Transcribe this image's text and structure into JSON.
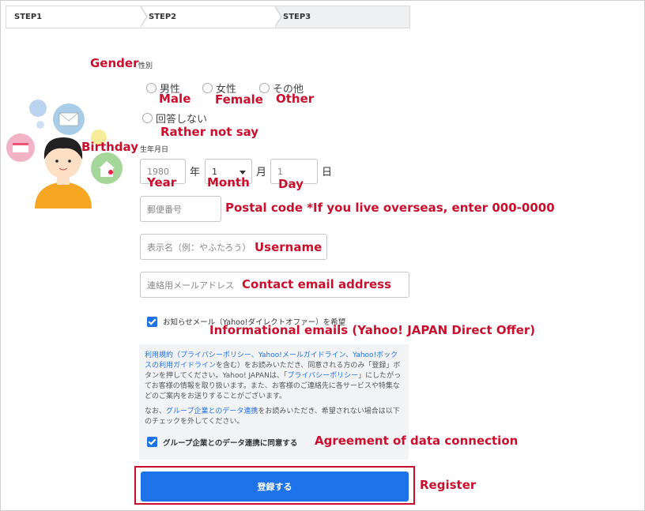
{
  "steps": [
    "STEP1",
    "STEP2",
    "STEP3"
  ],
  "gender": {
    "annotation": "Gender",
    "label": "性別",
    "options": [
      {
        "label": "男性",
        "translation": "Male"
      },
      {
        "label": "女性",
        "translation": "Female"
      },
      {
        "label": "その他",
        "translation": "Other"
      },
      {
        "label": "回答しない",
        "translation": "Rather not say"
      }
    ]
  },
  "birthday": {
    "annotation": "Birthday",
    "label": "生年月日",
    "year_placeholder": "1980",
    "year_unit": "年",
    "year_translation": "Year",
    "month_value": "1",
    "month_unit": "月",
    "month_translation": "Month",
    "day_placeholder": "1",
    "day_unit": "日",
    "day_translation": "Day"
  },
  "postal": {
    "placeholder": "郵便番号",
    "annotation": "Postal code *If you live overseas, enter 000-0000"
  },
  "username": {
    "placeholder": "表示名（例：やふたろう）",
    "annotation": "Username"
  },
  "email": {
    "placeholder": "連絡用メールアドレス",
    "annotation": "Contact email address"
  },
  "newsletter": {
    "label": "お知らせメール（Yahoo!ダイレクトオファー）を希望",
    "annotation": "Informational emails (Yahoo! JAPAN Direct Offer)",
    "checked": true
  },
  "terms": {
    "p1_link1": "利用規約（",
    "p1_link2": "プライバシーポリシー",
    "p1_sep1": "、",
    "p1_link3": "Yahoo!メールガイドライン",
    "p1_sep2": "、",
    "p1_link4": "Yahoo!ボックスの利用ガイドライン",
    "p1_text1": "を含む）",
    "p1_text2": "をお読みいただき、同意される方のみ「登録」ボタンを押してください。Yahoo! JAPANは、「",
    "p1_link5": "プライバシーポリシー",
    "p1_text3": "」にしたがってお客様の情報を取り扱います。また、お客様のご連絡先に各サービスや特集などのご案内をお送りすることがございます。",
    "p2_text1": "なお、",
    "p2_link": "グループ企業とのデータ連携",
    "p2_text2": "をお読みいただき、希望されない場合は以下のチェックを外してください。",
    "agree_label": "グループ企業とのデータ連携に同意する",
    "agree_annotation": "Agreement of data connection",
    "agree_checked": true
  },
  "register": {
    "label": "登録する",
    "annotation": "Register"
  },
  "colors": {
    "accent": "#1f73e8",
    "annotation_red": "#c8102e",
    "panel_bg": "#f2f3f5"
  }
}
